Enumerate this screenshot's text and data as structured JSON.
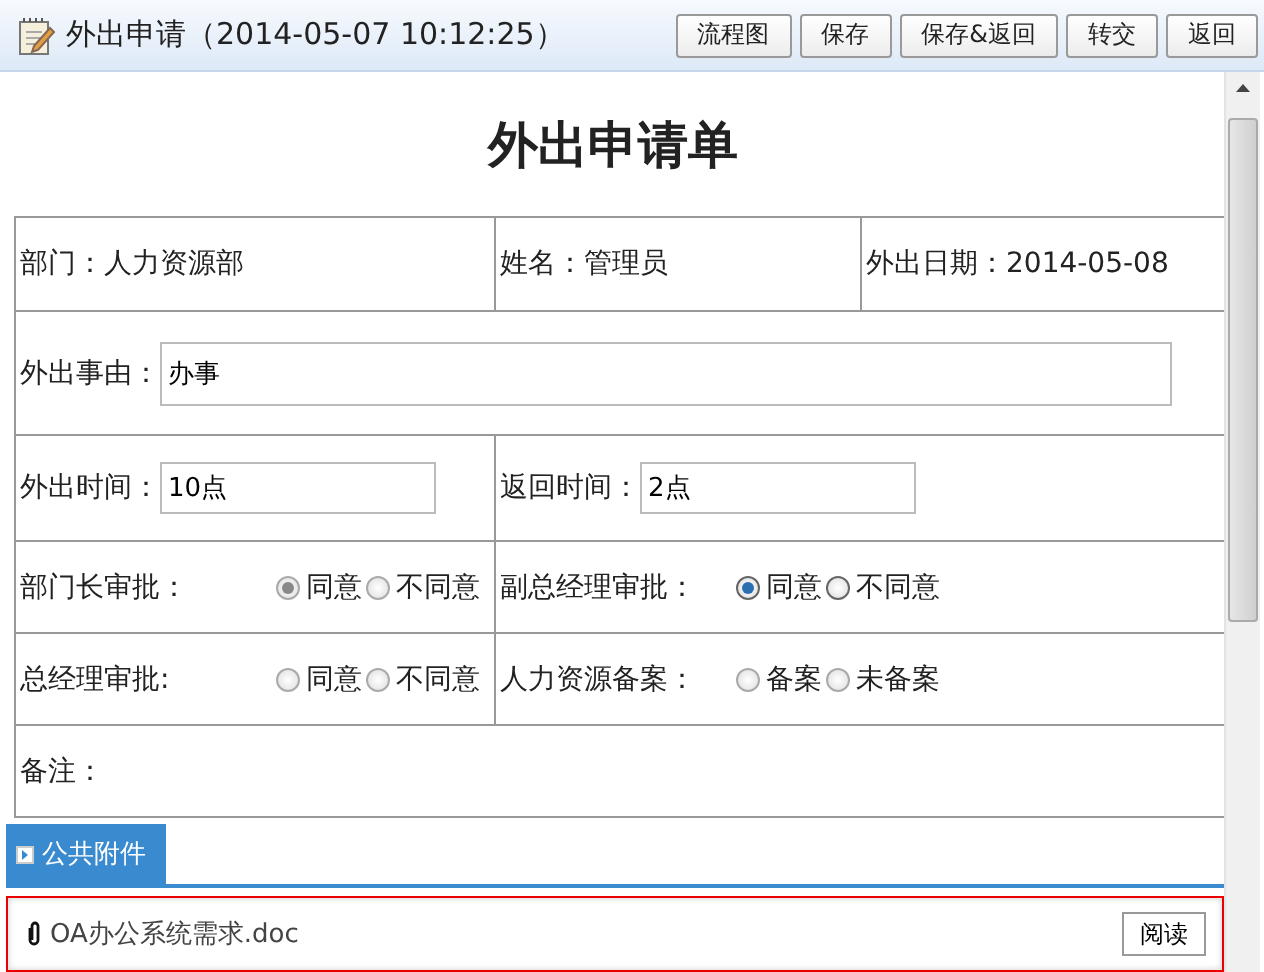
{
  "window": {
    "title": "外出申请（2014-05-07 10:12:25）"
  },
  "toolbar": [
    "流程图",
    "保存",
    "保存&返回",
    "转交",
    "返回"
  ],
  "form": {
    "title": "外出申请单",
    "info": [
      {
        "label": "部门：",
        "value": "人力资源部"
      },
      {
        "label": "姓名：",
        "value": "管理员"
      },
      {
        "label": "外出日期：",
        "value": "2014-05-08"
      }
    ],
    "reason": {
      "label": "外出事由：",
      "value": "办事"
    },
    "times": [
      {
        "label": "外出时间：",
        "value": "10点"
      },
      {
        "label": "返回时间：",
        "value": "2点"
      }
    ],
    "approvals": [
      {
        "label": "部门长审批：",
        "disabled": true,
        "options": [
          {
            "label": "同意",
            "selected": true
          },
          {
            "label": "不同意",
            "selected": false
          }
        ]
      },
      {
        "label": "副总经理审批：",
        "disabled": false,
        "options": [
          {
            "label": "同意",
            "selected": true
          },
          {
            "label": "不同意",
            "selected": false
          }
        ]
      },
      {
        "label": "总经理审批:",
        "disabled": true,
        "options": [
          {
            "label": "同意",
            "selected": false
          },
          {
            "label": "不同意",
            "selected": false
          }
        ]
      },
      {
        "label": "人力资源备案：",
        "disabled": true,
        "options": [
          {
            "label": "备案",
            "selected": false
          },
          {
            "label": "未备案",
            "selected": false
          }
        ]
      }
    ],
    "remarks": {
      "label": "备注："
    }
  },
  "attachments": {
    "tab": {
      "label": "公共附件",
      "selected": true
    },
    "files": [
      {
        "name": "OA办公系统需求.doc",
        "action": "阅读"
      }
    ]
  }
}
